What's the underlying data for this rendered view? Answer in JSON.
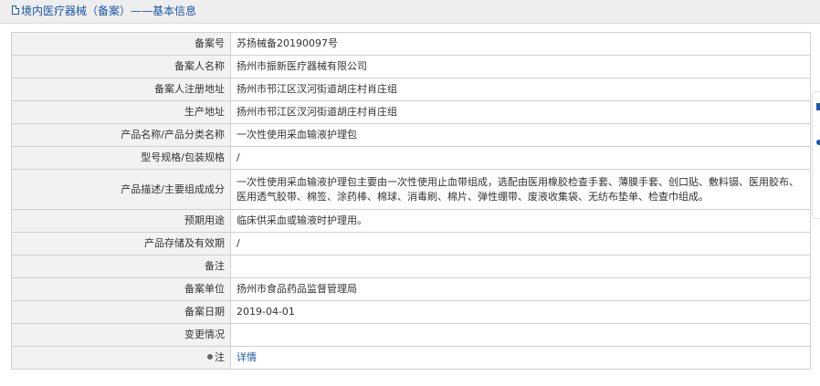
{
  "header": {
    "title": "境内医疗器械（备案）——基本信息",
    "icon": "document-icon"
  },
  "rows": [
    {
      "label": "备案号",
      "value": "苏扬械备20190097号"
    },
    {
      "label": "备案人名称",
      "value": "扬州市振新医疗器械有限公司"
    },
    {
      "label": "备案人注册地址",
      "value": "扬州市邗江区汊河街道胡庄村肖庄组"
    },
    {
      "label": "生产地址",
      "value": "扬州市邗江区汊河街道胡庄村肖庄组"
    },
    {
      "label": "产品名称/产品分类名称",
      "value": "一次性使用采血输液护理包"
    },
    {
      "label": "型号规格/包装规格",
      "value": "/"
    },
    {
      "label": "产品描述/主要组成成分",
      "value": "一次性使用采血输液护理包主要由一次性使用止血带组成，选配由医用橡胶检查手套、薄膜手套、创口贴、敷料镊、医用胶布、医用透气胶带、棉签、涂药棒、棉球、消毒刷、棉片、弹性绷带、废液收集袋、无纺布垫单、检查巾组成。"
    },
    {
      "label": "预期用途",
      "value": "临床供采血或输液时护理用。"
    },
    {
      "label": "产品存储及有效期",
      "value": "/"
    },
    {
      "label": "备注",
      "value": ""
    },
    {
      "label": "备案单位",
      "value": "扬州市食品药品监督管理局"
    },
    {
      "label": "备案日期",
      "value": "2019-04-01"
    },
    {
      "label": "变更情况",
      "value": ""
    },
    {
      "label": "注",
      "value": "详情",
      "icon": "pin-icon"
    }
  ],
  "colors": {
    "link": "#1a56a8",
    "label_bg": "#f2f2f2",
    "border": "#d0d0d0",
    "header_bg": "#eeeeee"
  }
}
